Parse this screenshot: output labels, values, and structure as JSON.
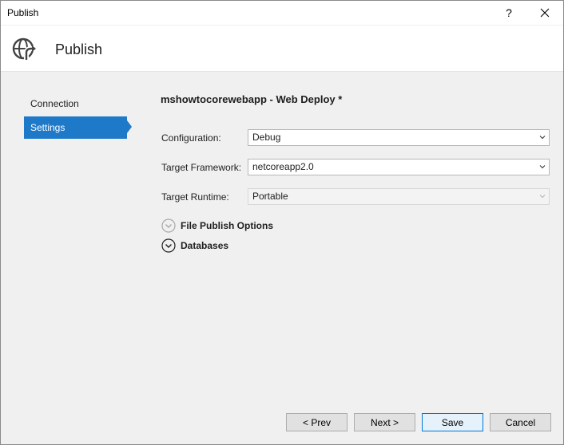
{
  "window": {
    "title": "Publish",
    "help_label": "?"
  },
  "header": {
    "title": "Publish"
  },
  "nav": {
    "items": [
      {
        "label": "Connection"
      },
      {
        "label": "Settings"
      }
    ]
  },
  "profile": {
    "title": "mshowtocorewebapp - Web Deploy *"
  },
  "fields": {
    "configuration": {
      "label": "Configuration:",
      "value": "Debug"
    },
    "target_framework": {
      "label": "Target Framework:",
      "value": "netcoreapp2.0"
    },
    "target_runtime": {
      "label": "Target Runtime:",
      "value": "Portable"
    }
  },
  "expanders": {
    "file_publish": {
      "label": "File Publish Options"
    },
    "databases": {
      "label": "Databases"
    }
  },
  "buttons": {
    "prev": "< Prev",
    "next": "Next >",
    "save": "Save",
    "cancel": "Cancel"
  },
  "colors": {
    "accent": "#1f79c9",
    "window_bg": "#f0f0f0"
  }
}
